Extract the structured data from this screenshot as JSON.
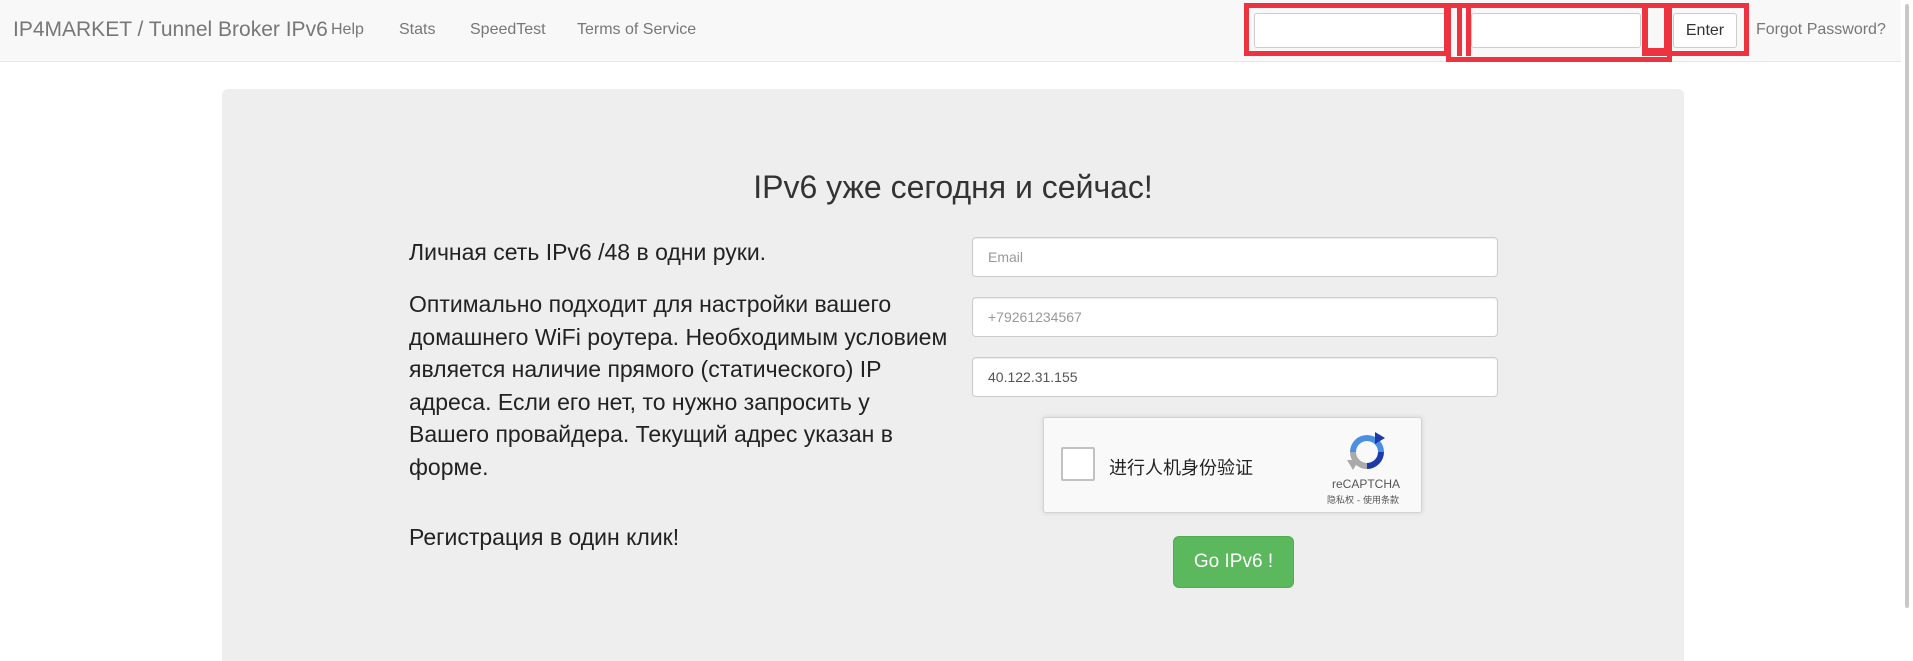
{
  "navbar": {
    "brand": "IP4MARKET / Tunnel Broker IPv6",
    "links": [
      "Help",
      "Stats",
      "SpeedTest",
      "Terms of Service"
    ],
    "login": {
      "email_value": "",
      "password_value": "",
      "enter_label": "Enter",
      "forgot_label": "Forgot Password?"
    }
  },
  "hero": {
    "title": "IPv6 уже сегодня и сейчас!",
    "lead": "Личная сеть IPv6 /48 в одни руки.",
    "body": "Оптимально подходит для настройки вашего домашнего WiFi роутера. Необходимым условием является наличие прямого (статического) IP адреса. Если его нет, то нужно запросить у Вашего провайдера. Текущий адрес указан в форме.",
    "registration": "Регистрация в один клик!"
  },
  "form": {
    "email_placeholder": "Email",
    "phone_placeholder": "+79261234567",
    "ip_value": "40.122.31.155",
    "recaptcha": {
      "label": "进行人机身份验证",
      "brand": "reCAPTCHA",
      "terms": "隐私权 - 使用条款"
    },
    "submit_label": "Go IPv6 !"
  },
  "colors": {
    "navbar_bg": "#f8f8f8",
    "jumbotron_bg": "#eeeeee",
    "submit_bg": "#5cb85c",
    "annotation_red": "#ee3340"
  }
}
